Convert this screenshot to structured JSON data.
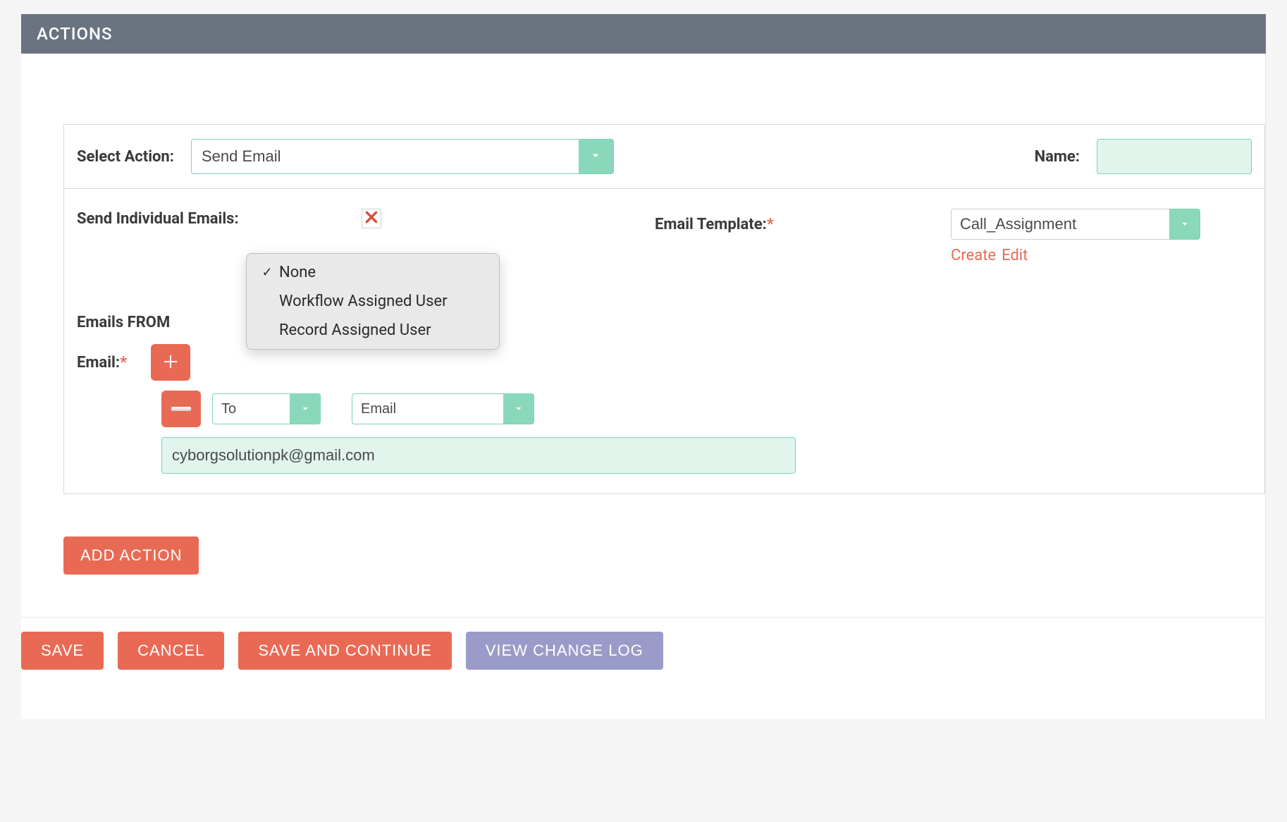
{
  "header": {
    "title": "ACTIONS"
  },
  "action_panel": {
    "select_action_label": "Select Action:",
    "select_action_value": "Send Email",
    "name_label": "Name:",
    "name_value": "",
    "send_individual_label": "Send Individual Emails:",
    "send_individual_checked": true,
    "email_template_label": "Email Template:",
    "email_template_value": "Call_Assignment",
    "create_link": "Create",
    "edit_link": "Edit",
    "emails_from_label": "Emails FROM",
    "emails_from_dropdown": {
      "selected": "None",
      "options": [
        "None",
        "Workflow Assigned User",
        "Record Assigned User"
      ]
    },
    "email_label": "Email:",
    "recipient_row": {
      "to_value": "To",
      "field_value": "Email"
    },
    "email_value": "cyborgsolutionpk@gmail.com"
  },
  "buttons": {
    "add_action": "ADD ACTION",
    "save": "SAVE",
    "cancel": "CANCEL",
    "save_continue": "SAVE AND CONTINUE",
    "view_change_log": "VIEW CHANGE LOG"
  }
}
